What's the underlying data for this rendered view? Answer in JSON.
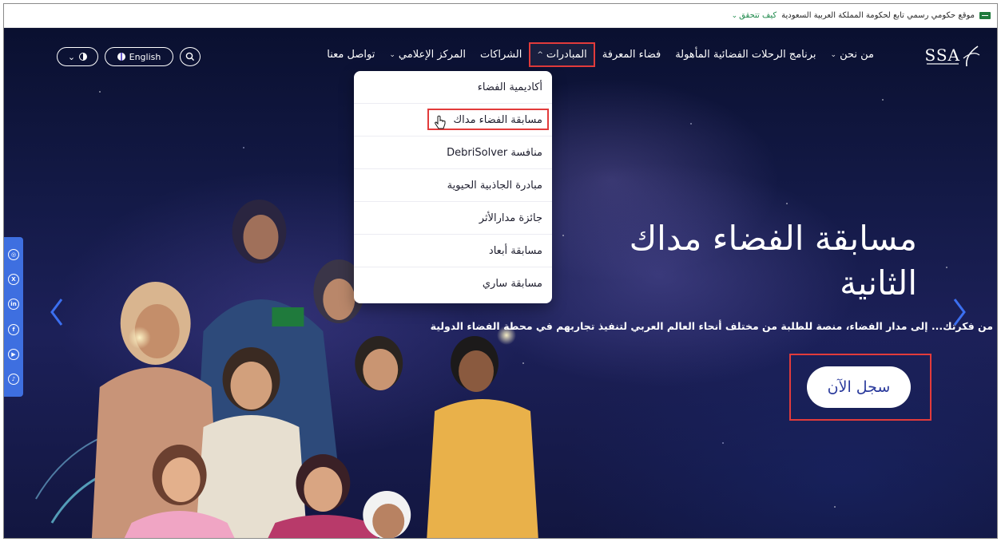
{
  "gov_bar": {
    "text": "موقع حكومي رسمي تابع لحكومة المملكة العربية السعودية",
    "verify_link": "كيف تتحقق"
  },
  "logo": {
    "text": "SSA"
  },
  "nav": {
    "items": [
      {
        "label": "من نحن",
        "has_caret": true
      },
      {
        "label": "برنامج الرحلات الفضائية المأهولة",
        "has_caret": false
      },
      {
        "label": "فضاء المعرفة",
        "has_caret": false
      },
      {
        "label": "المبادرات",
        "has_caret": true,
        "active": true
      },
      {
        "label": "الشراكات",
        "has_caret": false
      },
      {
        "label": "المركز الإعلامي",
        "has_caret": true
      },
      {
        "label": "تواصل معنا",
        "has_caret": false
      }
    ],
    "language_label": "English"
  },
  "dropdown": {
    "items": [
      "أكاديمية الفضاء",
      "مسابقة الفضاء مداك",
      "منافسة DebriSolver",
      "مبادرة الجاذبية الحيوية",
      "جائزة مدارالأثر",
      "مسابقة أبعاد",
      "مسابقة ساري"
    ],
    "highlighted_index": 1
  },
  "hero": {
    "title_line1": "مسابقة الفضاء مداك",
    "title_line2": "الثانية",
    "subtitle": "من فكرتك... إلى مدار الفضاء، منصة للطلبة من مختلف أنحاء العالم العربي لتنفيذ تجاربهم في محطة الفضاء الدولية",
    "cta_label": "سجل الآن"
  },
  "social": [
    "instagram-icon",
    "x-icon",
    "linkedin-icon",
    "facebook-icon",
    "youtube-icon",
    "tiktok-icon"
  ],
  "colors": {
    "accent_blue": "#3b6ff0",
    "highlight_red": "#e23b3b",
    "gov_green": "#1f8a4c"
  }
}
